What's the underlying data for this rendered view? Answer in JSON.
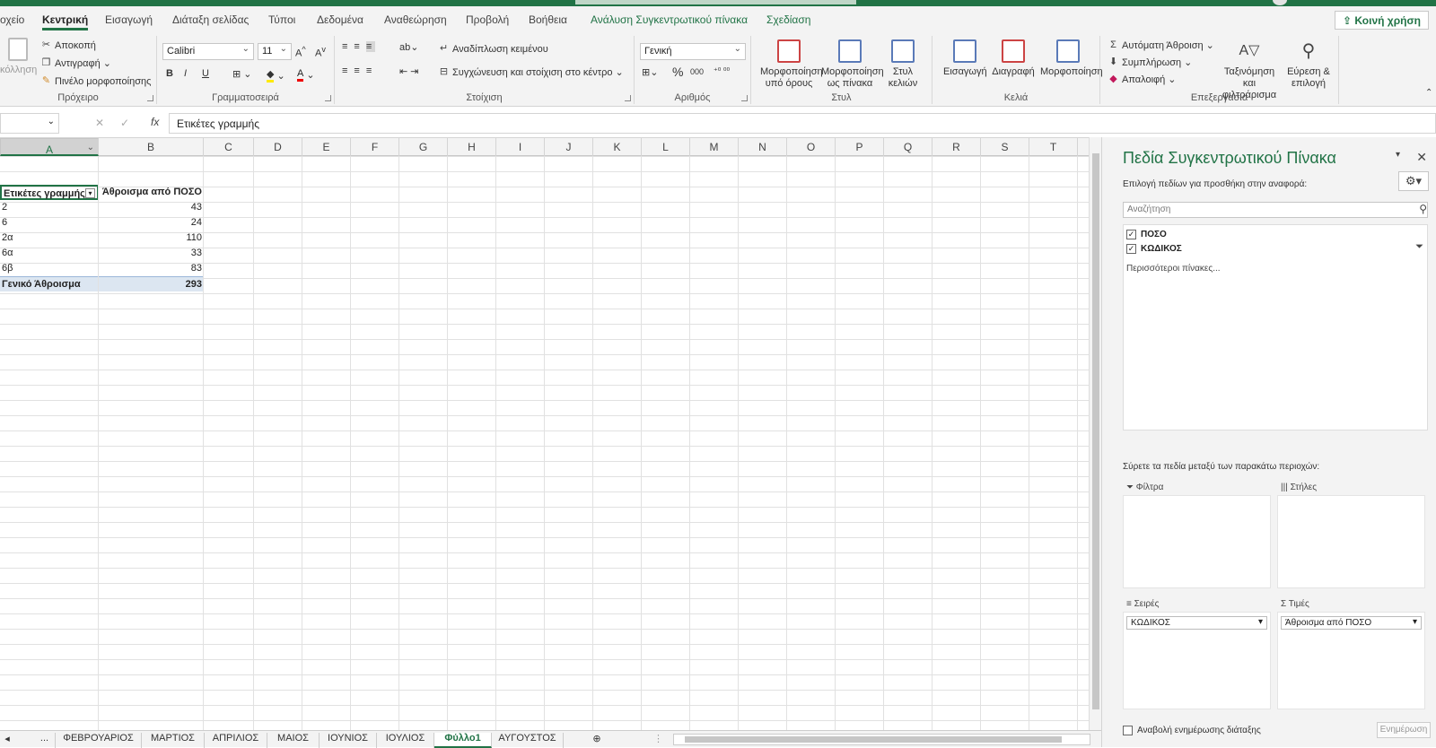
{
  "ribbon_tabs": [
    "οχείο",
    "Κεντρική",
    "Εισαγωγή",
    "Διάταξη σελίδας",
    "Τύποι",
    "Δεδομένα",
    "Αναθεώρηση",
    "Προβολή",
    "Βοήθεια",
    "Ανάλυση Συγκεντρωτικού πίνακα",
    "Σχεδίαση"
  ],
  "share_label": "Κοινή χρήση",
  "clipboard": {
    "paste": "κόλληση",
    "cut": "Αποκοπή",
    "copy": "Αντιγραφή",
    "painter": "Πινέλο μορφοποίησης",
    "group": "Πρόχειρο"
  },
  "font": {
    "name": "Calibri",
    "size": "11",
    "group": "Γραμματοσειρά",
    "bold": "B",
    "italic": "I",
    "underline": "U"
  },
  "alignment": {
    "wrap": "Αναδίπλωση κειμένου",
    "merge": "Συγχώνευση και στοίχιση στο κέντρο",
    "group": "Στοίχιση"
  },
  "number": {
    "format": "Γενική",
    "group": "Αριθμός"
  },
  "styles": {
    "cond": "Μορφοποίηση\nυπό όρους",
    "table": "Μορφοποίηση\nως πίνακα",
    "cell": "Στυλ\nκελιών",
    "group": "Στυλ"
  },
  "cells": {
    "insert": "Εισαγωγή",
    "delete": "Διαγραφή",
    "format": "Μορφοποίηση",
    "group": "Κελιά"
  },
  "editing": {
    "autosum": "Αυτόματη Άθροιση",
    "fill": "Συμπλήρωση",
    "clear": "Απαλοιφή",
    "sort": "Ταξινόμηση και\nφιλτράρισμα",
    "find": "Εύρεση &\nεπιλογή",
    "group": "Επεξεργασία"
  },
  "formula": {
    "content": "Ετικέτες γραμμής",
    "fx": "fx"
  },
  "columns": [
    "A",
    "B",
    "C",
    "D",
    "E",
    "F",
    "G",
    "H",
    "I",
    "J",
    "K",
    "L",
    "M",
    "N",
    "O",
    "P",
    "Q",
    "R",
    "S",
    "T"
  ],
  "pivot": {
    "header_label": "Ετικέτες γραμμής",
    "header_value": "Άθροισμα από ΠΟΣΟ",
    "rows": [
      {
        "label": "2",
        "value": "43"
      },
      {
        "label": "6",
        "value": "24"
      },
      {
        "label": "2α",
        "value": "110"
      },
      {
        "label": "6α",
        "value": "33"
      },
      {
        "label": "6β",
        "value": "83"
      }
    ],
    "total_label": "Γενικό Άθροισμα",
    "total_value": "293"
  },
  "sheets": [
    "...",
    "ΦΕΒΡΟΥΑΡΙΟΣ",
    "ΜΑΡΤΙΟΣ",
    "ΑΠΡΙΛΙΟΣ",
    "ΜΑΙΟΣ",
    "ΙΟΥΝΙΟΣ",
    "ΙΟΥΛΙΟΣ",
    "Φύλλο1",
    "ΑΥΓΟΥΣΤΟΣ"
  ],
  "active_sheet": "Φύλλο1",
  "pane": {
    "title": "Πεδία Συγκεντρωτικού Πίνακα",
    "subtitle": "Επιλογή πεδίων για προσθήκη στην αναφορά:",
    "search_placeholder": "Αναζήτηση",
    "fields": [
      "ΠΟΣΟ",
      "ΚΩΔΙΚΟΣ"
    ],
    "more_tables": "Περισσότεροι πίνακες...",
    "drag_hint": "Σύρετε τα πεδία μεταξύ των παρακάτω περιοχών:",
    "filters": "Φίλτρα",
    "columns": "Στήλες",
    "rows": "Σειρές",
    "values": "Τιμές",
    "rows_field": "ΚΩΔΙΚΟΣ",
    "values_field": "Άθροισμα από ΠΟΣΟ",
    "defer": "Αναβολή ενημέρωσης διάταξης",
    "update": "Ενημέρωση"
  }
}
